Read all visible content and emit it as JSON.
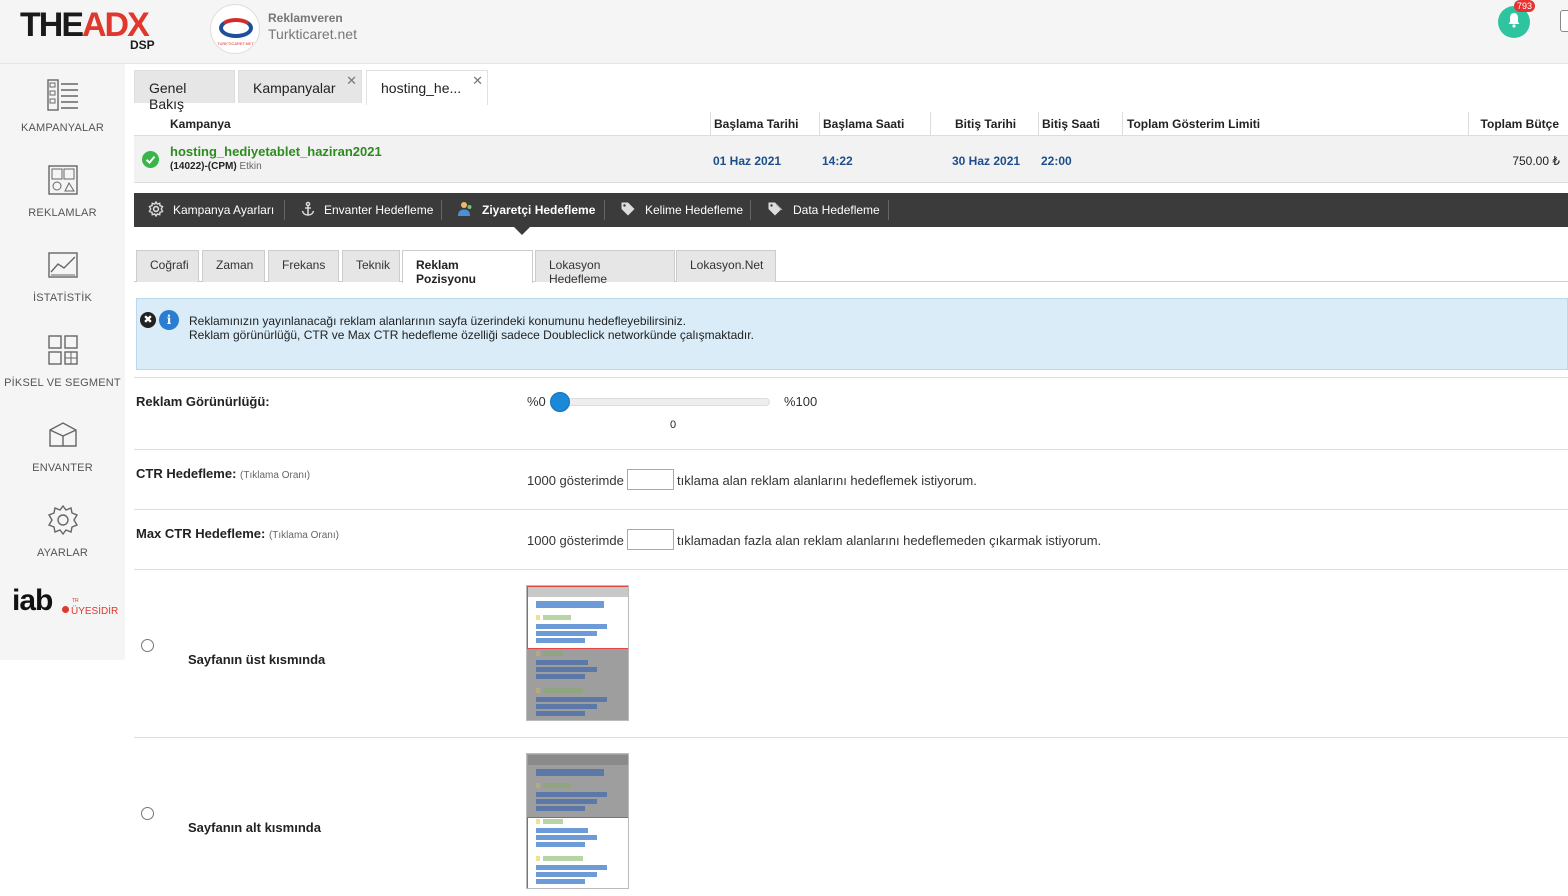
{
  "header": {
    "logo_main": "THE",
    "logo_accent": "ADX",
    "logo_sub": "DSP",
    "advertiser_label": "Reklamveren",
    "advertiser_name": "Turkticaret.net",
    "advertiser_logo_text": "TURKTICARET.NET",
    "notification_count": "793",
    "colors": {
      "accent": "#e0382c",
      "bell": "#2ec4a0",
      "badge": "#e53333"
    }
  },
  "sidebar": {
    "items": [
      {
        "label": "KAMPANYALAR",
        "icon": "campaigns-icon"
      },
      {
        "label": "REKLAMLAR",
        "icon": "ads-icon"
      },
      {
        "label": "İSTATİSTİK",
        "icon": "statistics-icon"
      },
      {
        "label": "PİKSEL VE SEGMENT",
        "icon": "pixel-segment-icon"
      },
      {
        "label": "ENVANTER",
        "icon": "inventory-icon"
      },
      {
        "label": "AYARLAR",
        "icon": "settings-icon"
      }
    ],
    "iab": {
      "text": "iab",
      "member": "ÜYESİDİR",
      "small": "TR"
    }
  },
  "main_tabs": [
    {
      "label": "Genel Bakış",
      "closable": false
    },
    {
      "label": "Kampanyalar",
      "closable": true
    },
    {
      "label": "hosting_he...",
      "closable": true,
      "active": true
    }
  ],
  "campaign_table": {
    "headers": {
      "campaign": "Kampanya",
      "start_date": "Başlama Tarihi",
      "start_time": "Başlama Saati",
      "end_date": "Bitiş Tarihi",
      "end_time": "Bitiş Saati",
      "impression_limit": "Toplam Gösterim Limiti",
      "budget": "Toplam Bütçe"
    },
    "row": {
      "name": "hosting_hediyetablet_haziran2021",
      "info": "(14022)-(CPM)",
      "status": "Etkin",
      "start_date": "01 Haz 2021",
      "start_time": "14:22",
      "end_date": "30 Haz 2021",
      "end_time": "22:00",
      "impression_limit": "",
      "budget": "750.00 ₺"
    }
  },
  "section_nav": [
    {
      "label": "Kampanya Ayarları",
      "icon": "gear-icon"
    },
    {
      "label": "Envanter Hedefleme",
      "icon": "anchor-icon"
    },
    {
      "label": "Ziyaretçi Hedefleme",
      "icon": "visitor-icon",
      "active": true
    },
    {
      "label": "Kelime Hedefleme",
      "icon": "tag-icon"
    },
    {
      "label": "Data Hedefleme",
      "icon": "data-tag-icon"
    }
  ],
  "sub_tabs": [
    {
      "label": "Coğrafi"
    },
    {
      "label": "Zaman"
    },
    {
      "label": "Frekans"
    },
    {
      "label": "Teknik"
    },
    {
      "label": "Reklam Pozisyonu",
      "active": true
    },
    {
      "label": "Lokasyon Hedefleme"
    },
    {
      "label": "Lokasyon.Net"
    }
  ],
  "info_box": {
    "line1": "Reklamınızın yayınlanacağı reklam alanlarının sayfa üzerindeki konumunu hedefleyebilirsiniz.",
    "line2": "Reklam görünürlüğü, CTR ve Max CTR hedefleme özelliği sadece Doubleclick networkünde çalışmaktadır.",
    "close_glyph": "✖",
    "info_glyph": "i"
  },
  "visibility": {
    "label": "Reklam Görünürlüğü:",
    "min_label": "%0",
    "max_label": "%100",
    "value": "0",
    "fraction": 0
  },
  "ctr": {
    "label": "CTR Hedefleme:",
    "hint": "(Tıklama Oranı)",
    "prefix": "1000 gösterimde",
    "suffix": "tıklama alan reklam alanlarını hedeflemek istiyorum.",
    "value": ""
  },
  "max_ctr": {
    "label": "Max CTR Hedefleme:",
    "hint": "(Tıklama Oranı)",
    "prefix": "1000 gösterimde",
    "suffix": "tıklamadan fazla alan reklam alanlarını hedeflemeden çıkarmak istiyorum.",
    "value": ""
  },
  "positions": [
    {
      "label": "Sayfanın üst kısmında",
      "selected": false
    },
    {
      "label": "Sayfanın alt kısmında",
      "selected": false
    }
  ]
}
